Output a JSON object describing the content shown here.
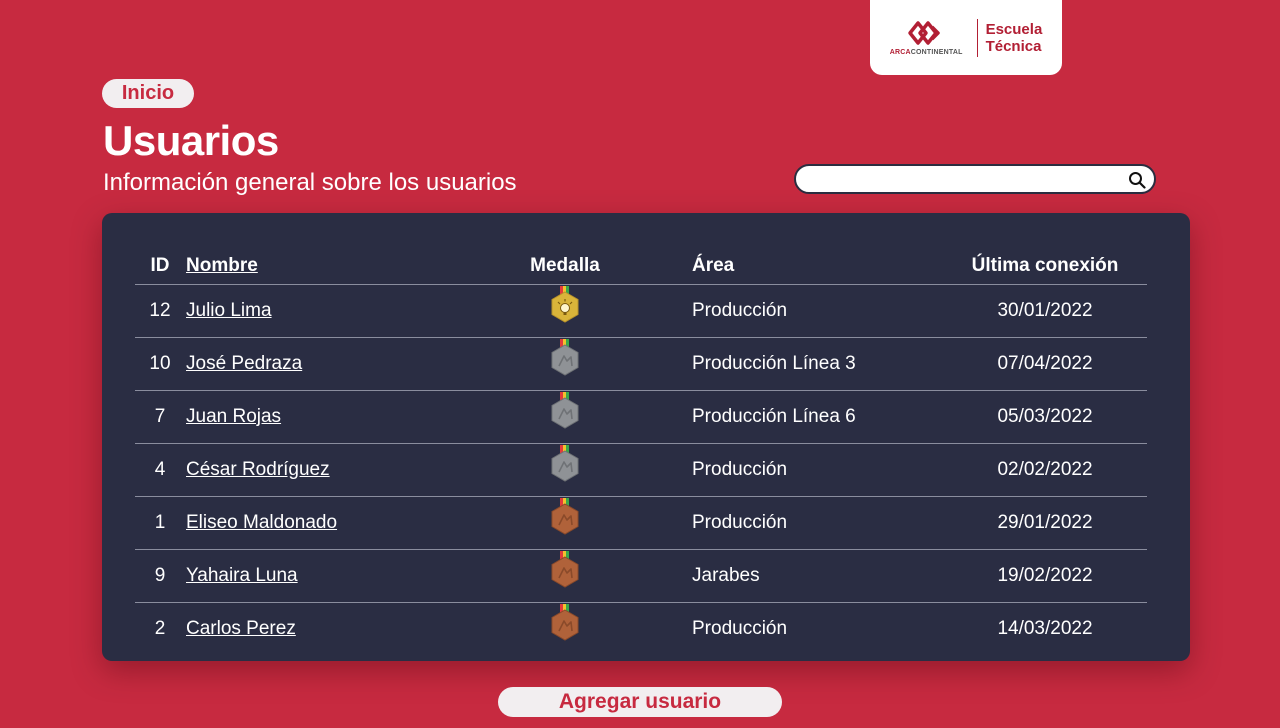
{
  "logo": {
    "brand_bold": "ARCA",
    "brand_light": "CONTINENTAL",
    "school_line1": "Escuela",
    "school_line2": "Técnica"
  },
  "nav": {
    "inicio_label": "Inicio"
  },
  "header": {
    "title": "Usuarios",
    "subtitle": "Información general sobre los usuarios"
  },
  "search": {
    "placeholder": "",
    "value": ""
  },
  "table": {
    "columns": {
      "id": "ID",
      "name": "Nombre",
      "medal": "Medalla",
      "area": "Área",
      "last_login": "Última conexión"
    },
    "rows": [
      {
        "id": "12",
        "name": "Julio Lima",
        "medal": "gold",
        "area": "Producción",
        "last_login": "30/01/2022"
      },
      {
        "id": "10",
        "name": "José Pedraza",
        "medal": "silver",
        "area": "Producción Línea 3",
        "last_login": "07/04/2022"
      },
      {
        "id": "7",
        "name": "Juan Rojas",
        "medal": "silver",
        "area": "Producción Línea 6",
        "last_login": "05/03/2022"
      },
      {
        "id": "4",
        "name": "César Rodríguez",
        "medal": "silver",
        "area": "Producción",
        "last_login": "02/02/2022"
      },
      {
        "id": "1",
        "name": "Eliseo Maldonado",
        "medal": "bronze",
        "area": "Producción",
        "last_login": "29/01/2022"
      },
      {
        "id": "9",
        "name": "Yahaira Luna",
        "medal": "bronze",
        "area": "Jarabes",
        "last_login": "19/02/2022"
      },
      {
        "id": "2",
        "name": "Carlos Perez",
        "medal": "bronze",
        "area": "Producción",
        "last_login": "14/03/2022"
      }
    ]
  },
  "actions": {
    "add_user_label": "Agregar usuario"
  },
  "colors": {
    "background": "#c72a40",
    "card": "#2a2d43",
    "gold": "#d9b43a",
    "silver": "#8f9296",
    "bronze": "#b0623a"
  },
  "icons": {
    "search": "search-icon",
    "medal_gold": "gold-medal-icon",
    "medal_silver": "silver-medal-icon",
    "medal_bronze": "bronze-medal-icon"
  }
}
